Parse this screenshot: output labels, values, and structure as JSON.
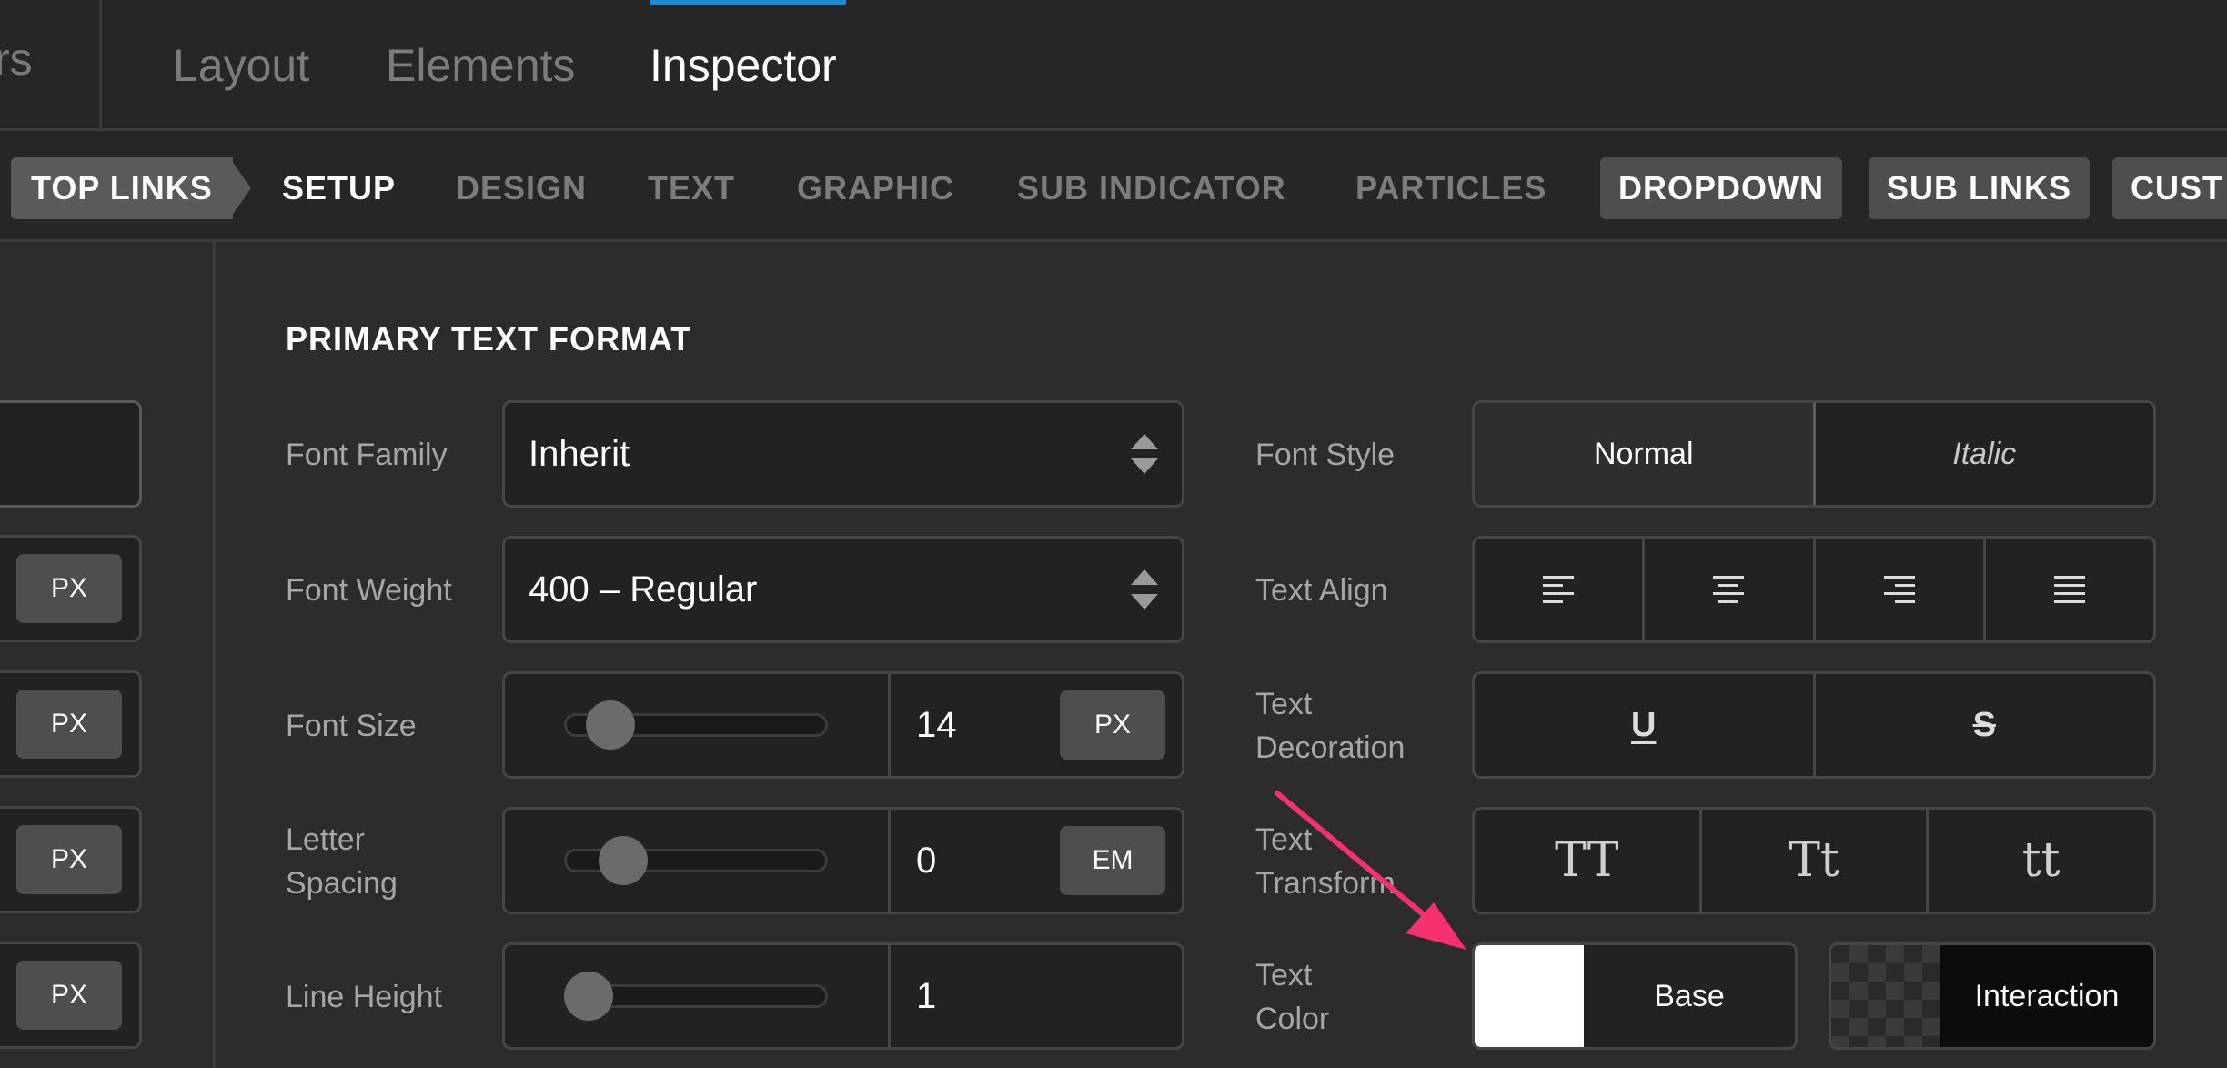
{
  "top_tabs": {
    "partial_label": "rs",
    "items": [
      {
        "label": "Layout",
        "active": false
      },
      {
        "label": "Elements",
        "active": false
      },
      {
        "label": "Inspector",
        "active": true
      }
    ],
    "indicator_color": "#1e8ad6"
  },
  "subnav": {
    "breadcrumb": "TOP LINKS",
    "items": [
      {
        "label": "SETUP",
        "active": true
      },
      {
        "label": "DESIGN",
        "active": false
      },
      {
        "label": "TEXT",
        "active": false
      },
      {
        "label": "GRAPHIC",
        "active": false
      },
      {
        "label": "SUB INDICATOR",
        "active": false
      },
      {
        "label": "PARTICLES",
        "active": false
      }
    ],
    "pills": [
      "DROPDOWN",
      "SUB LINKS",
      "CUST"
    ]
  },
  "left_column": {
    "unit_buttons": [
      "PX",
      "PX",
      "PX",
      "PX"
    ]
  },
  "primary_text_format": {
    "title": "PRIMARY TEXT FORMAT",
    "font_family": {
      "label": "Font Family",
      "value": "Inherit"
    },
    "font_weight": {
      "label": "Font Weight",
      "value": "400 – Regular"
    },
    "font_size": {
      "label": "Font Size",
      "value": "14",
      "unit": "PX",
      "slider_fraction": 0.1
    },
    "letter_spacing": {
      "label_line1": "Letter",
      "label_line2": "Spacing",
      "value": "0",
      "unit": "EM",
      "slider_fraction": 0.16
    },
    "line_height": {
      "label": "Line Height",
      "value": "1",
      "slider_fraction": 0.0
    },
    "font_style": {
      "label": "Font Style",
      "options": [
        "Normal",
        "Italic"
      ],
      "selected": "Normal"
    },
    "text_align": {
      "label": "Text Align",
      "options": [
        "align-left-icon",
        "align-center-icon",
        "align-right-icon",
        "align-justify-icon"
      ]
    },
    "text_decoration": {
      "label_line1": "Text",
      "label_line2": "Decoration",
      "options": [
        "U",
        "S"
      ]
    },
    "text_transform": {
      "label_line1": "Text",
      "label_line2": "Transform",
      "options": [
        "TT",
        "Tt",
        "tt"
      ]
    },
    "text_color": {
      "label_line1": "Text",
      "label_line2": "Color",
      "base_label": "Base",
      "interaction_label": "Interaction",
      "base_color": "#ffffff"
    }
  },
  "annotation": {
    "arrow_color": "#f5306e"
  }
}
